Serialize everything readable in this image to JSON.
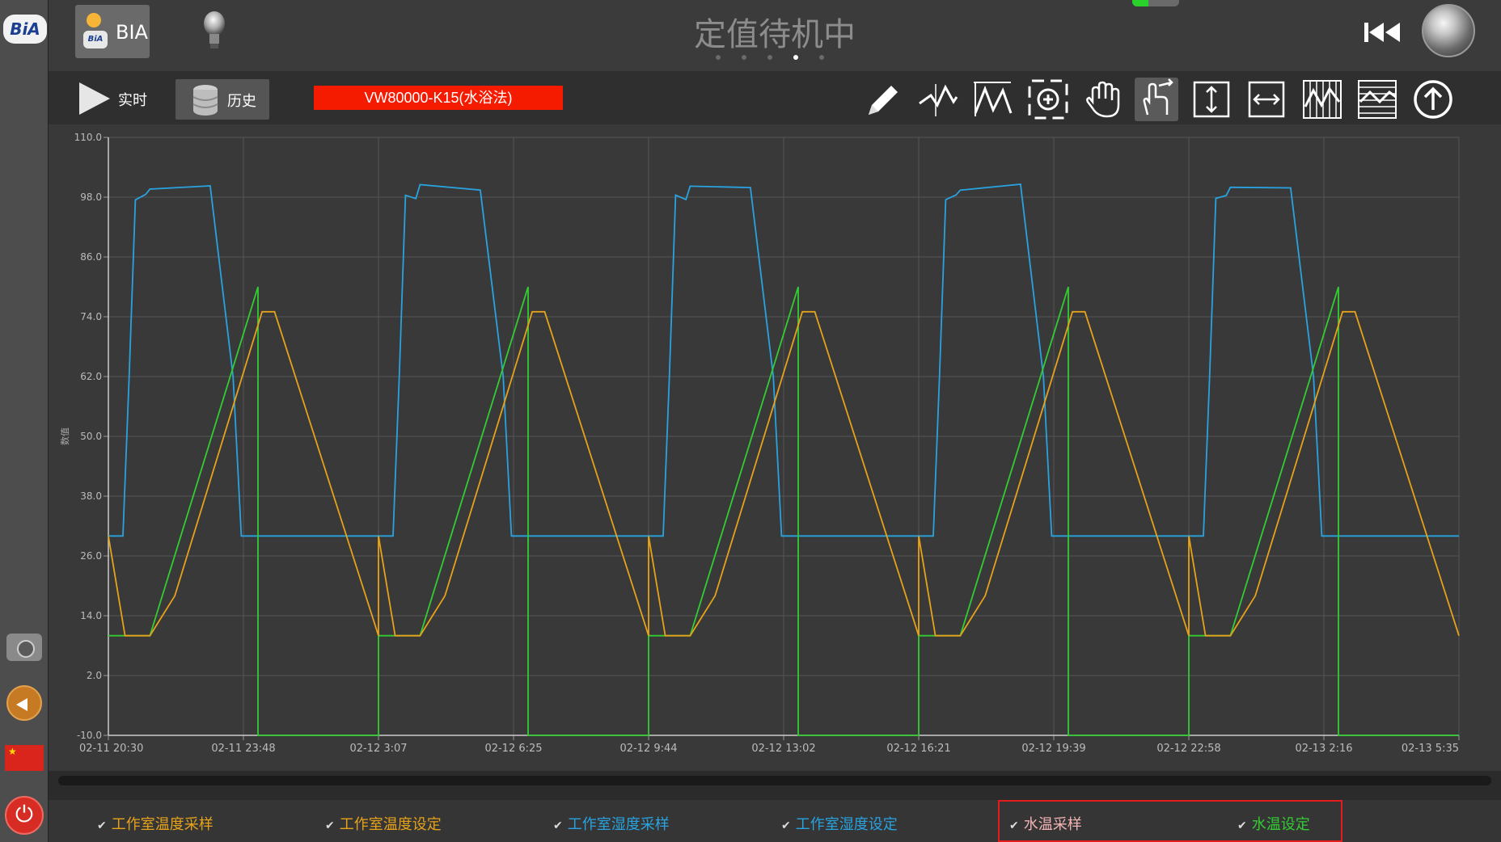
{
  "sidebar": {
    "logo_text": "BiA",
    "flag_mark": "★"
  },
  "topbar": {
    "bia_button_label": "BIA",
    "bia_mini_logo": "BiA",
    "status_title": "定值待机中",
    "page_indicator": {
      "count": 5,
      "active_index": 3
    },
    "progress_fraction": 0.35
  },
  "toolbar": {
    "realtime_label": "实时",
    "history_label": "历史",
    "device_tag": "VW80000-K15(水浴法)",
    "tools": [
      "pencil-icon",
      "line-icon",
      "peak-icon",
      "zoom-target-icon",
      "hand-pan-icon",
      "touch-pointer-icon",
      "vertical-expand-icon",
      "horizontal-expand-icon",
      "grid-vertical-icon",
      "grid-horizontal-icon",
      "upload-icon"
    ],
    "active_tool": "touch-pointer-icon"
  },
  "chart_data": {
    "type": "line",
    "ylabel": "数值",
    "ylim": [
      -10,
      110
    ],
    "yticks": [
      "110.0",
      "98.0",
      "86.0",
      "74.0",
      "62.0",
      "50.0",
      "38.0",
      "26.0",
      "14.0",
      "2.0",
      "-10.0"
    ],
    "xticks": [
      "02-11 20:30",
      "02-11 23:48",
      "02-12 3:07",
      "02-12 6:25",
      "02-12 9:44",
      "02-12 13:02",
      "02-12 16:21",
      "02-12 19:39",
      "02-12 22:58",
      "02-13 2:16",
      "02-13 5:35"
    ],
    "grid": true,
    "cycle_hours": 6.5,
    "cycles": 5,
    "series": [
      {
        "name": "水温采样",
        "color": "#29a3e0",
        "low": 30,
        "high": 100,
        "points_per_cycle": [
          [
            0,
            30
          ],
          [
            0.35,
            30
          ],
          [
            0.5,
            62
          ],
          [
            0.65,
            98
          ],
          [
            0.9,
            98
          ],
          [
            1.0,
            100
          ],
          [
            2.45,
            100
          ],
          [
            3.0,
            62
          ],
          [
            3.2,
            30
          ],
          [
            6.5,
            30
          ]
        ]
      },
      {
        "name": "水温设定",
        "color": "#33cc33",
        "points_per_cycle": [
          [
            0,
            10
          ],
          [
            1.0,
            10
          ],
          [
            3.6,
            80
          ],
          [
            3.6,
            -10
          ],
          [
            6.5,
            -10
          ]
        ]
      },
      {
        "name": "工作室温度采样",
        "color": "#e6a21a",
        "points_per_cycle": [
          [
            0,
            30
          ],
          [
            0.4,
            10
          ],
          [
            1.0,
            10
          ],
          [
            1.6,
            18
          ],
          [
            3.7,
            75
          ],
          [
            4.0,
            75
          ],
          [
            6.5,
            10
          ]
        ]
      }
    ]
  },
  "legend": [
    {
      "label": "工作室温度采样",
      "color": "#e6a21a"
    },
    {
      "label": "工作室温度设定",
      "color": "#e6a21a"
    },
    {
      "label": "工作室湿度采样",
      "color": "#29a3e0"
    },
    {
      "label": "工作室湿度设定",
      "color": "#29a3e0"
    },
    {
      "label": "水温采样",
      "color": "#f2b3b3"
    },
    {
      "label": "水温设定",
      "color": "#33cc33"
    }
  ],
  "colors": {
    "highlight": "#e51c1c",
    "device_tag_bg": "#f51b00"
  }
}
